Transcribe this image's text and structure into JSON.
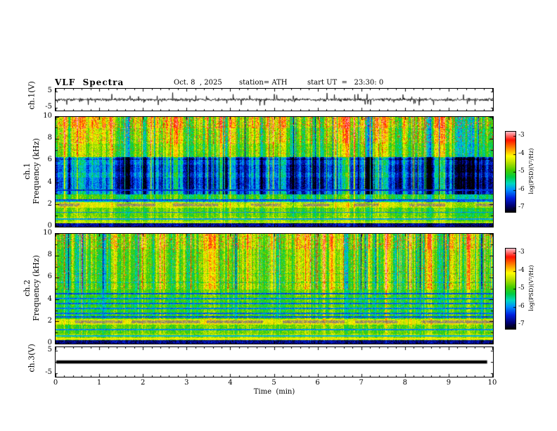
{
  "title": {
    "main": "VLF  Spectra",
    "date": "Oct. 8  , 2025",
    "station": "station= ATH",
    "start_ut": "start UT  =   23:30: 0"
  },
  "axes": {
    "time_label": "Time  (min)",
    "time_ticks": [
      "0",
      "1",
      "2",
      "3",
      "4",
      "5",
      "6",
      "7",
      "8",
      "9",
      "10"
    ],
    "freq_ticks": [
      "0",
      "2",
      "4",
      "6",
      "8",
      "10"
    ],
    "volt_tick_top": "5",
    "volt_tick_bottom": "-5",
    "wave1_label": "ch.1(V)",
    "wave3_label": "ch.3(V)",
    "spec1_ch": "ch.1",
    "spec2_ch": "ch.2",
    "freq_axis_label": "Frequency (kHz)",
    "colorbar_label": "log(PSD)(V²/Hz)",
    "colorbar_ticks": [
      "-3",
      "-4",
      "-5",
      "-6",
      "-7"
    ]
  },
  "colormap": {
    "stops": [
      [
        0.0,
        "#000000"
      ],
      [
        0.08,
        "#000070"
      ],
      [
        0.18,
        "#0020e0"
      ],
      [
        0.28,
        "#0090ff"
      ],
      [
        0.36,
        "#00d8c0"
      ],
      [
        0.44,
        "#00cc44"
      ],
      [
        0.52,
        "#44cc00"
      ],
      [
        0.62,
        "#b8e000"
      ],
      [
        0.7,
        "#ffff00"
      ],
      [
        0.8,
        "#ff8800"
      ],
      [
        0.9,
        "#ff1100"
      ],
      [
        1.0,
        "#ffb6c1"
      ]
    ],
    "zmin": -7,
    "zmax": -3
  },
  "chart_data": [
    {
      "panel": "ch1_waveform",
      "type": "line",
      "ylabel": "ch.1(V)",
      "ylim": [
        -6.5,
        6.5
      ],
      "yticks": [
        5,
        -5
      ],
      "xlim": [
        0,
        10
      ],
      "description": "Broadband VLF waveform: continuous noise of roughly ±1 V about 0 V with frequent impulsive sferic spikes reaching ±2 to ±4.5 V across the whole 10-minute record",
      "render": {
        "seed": 42,
        "noise_std": 0.7,
        "spike_prob": 0.045,
        "spike_amp": [
          0.8,
          3.8
        ]
      }
    },
    {
      "panel": "ch1_spectrogram",
      "type": "heatmap",
      "ylabel": "ch.1 Frequency (kHz)",
      "xlabel": "Time (min)",
      "xlim": [
        0,
        10
      ],
      "ylim": [
        0,
        10
      ],
      "zlim": [
        -7,
        -3
      ],
      "colorbar": "log(PSD)(V²/Hz)",
      "features": [
        "8-10 kHz: intense red/orange impulsive vertical sferic streaks on yellow-green background",
        "6.5-8 kHz: green background with yellow vertical streaks",
        "3-6.5 kHz: low-power dark blue region crossed by vertical green sferic streaks",
        "~2 kHz: strong quasi-continuous emission band (yellow/tan with gray saturated segments)",
        "0.3-2.6 kHz: structured green/yellow layers with narrow dark lines near 0.75, 1.35 and 2.45 kHz",
        "0-0.3 kHz: near-black low-frequency cutoff"
      ],
      "render": {
        "seed": 7,
        "burst_prob": 0.06,
        "dip_prob": 0.03,
        "bands": [
          {
            "f": [
              9.0,
              10.01
            ],
            "v": 0.62,
            "streak": 0.3,
            "speckle": 0.22
          },
          {
            "f": [
              7.6,
              9.0
            ],
            "v": 0.57,
            "streak": 0.26,
            "speckle": 0.12
          },
          {
            "f": [
              6.4,
              7.6
            ],
            "v": 0.53,
            "streak": 0.22,
            "speckle": 0.04
          },
          {
            "f": [
              3.0,
              6.4
            ],
            "v": 0.25,
            "streak": 0.26,
            "speckle": 0
          },
          {
            "f": [
              2.55,
              3.0
            ],
            "v": 0.47,
            "streak": 0.14,
            "speckle": 0
          },
          {
            "f": [
              2.25,
              2.55
            ],
            "v": 0.33,
            "streak": 0.1,
            "speckle": 0
          },
          {
            "f": [
              1.75,
              2.25
            ],
            "v": 0.64,
            "streak": 0.08,
            "speckle": 0
          },
          {
            "f": [
              0.9,
              1.75
            ],
            "v": 0.53,
            "streak": 0.1,
            "speckle": 0
          },
          {
            "f": [
              0.35,
              0.9
            ],
            "v": 0.58,
            "streak": 0.08,
            "speckle": 0
          },
          {
            "f": [
              0.0,
              0.35
            ],
            "v": 0.1,
            "streak": 0.05,
            "speckle": 0
          }
        ],
        "lines": [
          {
            "f": 4.0,
            "w": 0.5,
            "dv": -0.06
          },
          {
            "f": 5.3,
            "w": 0.35,
            "dv": -0.05
          },
          {
            "f": 6.2,
            "w": 0.06,
            "dv": -0.1
          },
          {
            "f": 3.35,
            "w": 0.08,
            "v": 0.18
          },
          {
            "f": 2.45,
            "w": 0.07,
            "v": 0.22
          },
          {
            "f": 1.35,
            "w": 0.06,
            "v": 0.28
          },
          {
            "f": 0.75,
            "w": 0.06,
            "v": 0.3
          },
          {
            "f": 0.45,
            "w": 0.05,
            "v": 0.66
          }
        ],
        "gray_band": {
          "f": [
            1.85,
            2.12
          ],
          "seg": [
            25,
            70
          ],
          "gap": [
            20,
            60
          ],
          "rgb": [
            150,
            142,
            105
          ]
        }
      }
    },
    {
      "panel": "ch2_spectrogram",
      "type": "heatmap",
      "ylabel": "ch.2 Frequency (kHz)",
      "xlabel": "Time (min)",
      "xlim": [
        0,
        10
      ],
      "ylim": [
        0,
        10
      ],
      "zlim": [
        -7,
        -3
      ],
      "colorbar": "log(PSD)(V²/Hz)",
      "features": [
        "8.5-10 kHz: red impulsive sferic streaks on yellow-green background",
        "5-8.5 kHz: green/yellow vertical striations with occasional dark blue columns",
        "2.3-4.7 kHz: green region with many narrow dark horizontal lines (~2.45, 2.8, 3.25, 3.7, 4.15, 4.6 kHz)",
        "~2 kHz: strong quasi-continuous emission band (yellow with long gray saturated segments)",
        "0.3-1.8 kHz: bright green/yellow layers with dark lines near 0.75 and 1.3 kHz",
        "0-0.3 kHz: near-black low-frequency cutoff"
      ],
      "render": {
        "seed": 13,
        "burst_prob": 0.05,
        "dip_prob": 0.05,
        "bands": [
          {
            "f": [
              8.6,
              10.01
            ],
            "v": 0.6,
            "streak": 0.28,
            "speckle": 0.16
          },
          {
            "f": [
              5.0,
              8.6
            ],
            "v": 0.56,
            "streak": 0.24,
            "speckle": 0.05
          },
          {
            "f": [
              4.4,
              5.0
            ],
            "v": 0.52,
            "streak": 0.14,
            "speckle": 0
          },
          {
            "f": [
              2.3,
              4.4
            ],
            "v": 0.5,
            "streak": 0.12,
            "speckle": 0
          },
          {
            "f": [
              1.75,
              2.25
            ],
            "v": 0.68,
            "streak": 0.06,
            "speckle": 0
          },
          {
            "f": [
              0.9,
              1.75
            ],
            "v": 0.55,
            "streak": 0.08,
            "speckle": 0
          },
          {
            "f": [
              0.35,
              0.9
            ],
            "v": 0.6,
            "streak": 0.06,
            "speckle": 0
          },
          {
            "f": [
              0.0,
              0.35
            ],
            "v": 0.1,
            "streak": 0.04,
            "speckle": 0
          }
        ],
        "lines": [
          {
            "f": 4.6,
            "w": 0.07,
            "v": 0.22
          },
          {
            "f": 4.15,
            "w": 0.05,
            "v": 0.26
          },
          {
            "f": 3.7,
            "w": 0.05,
            "v": 0.24
          },
          {
            "f": 3.25,
            "w": 0.05,
            "v": 0.26
          },
          {
            "f": 2.8,
            "w": 0.05,
            "v": 0.24
          },
          {
            "f": 2.45,
            "w": 0.06,
            "v": 0.22
          },
          {
            "f": 1.3,
            "w": 0.05,
            "v": 0.28
          },
          {
            "f": 0.75,
            "w": 0.05,
            "v": 0.32
          },
          {
            "f": 0.5,
            "w": 0.06,
            "v": 0.7
          },
          {
            "f": 5.6,
            "w": 0.05,
            "dv": -0.08
          },
          {
            "f": 6.4,
            "w": 0.05,
            "dv": -0.07
          }
        ],
        "gray_band": {
          "f": [
            1.85,
            2.12
          ],
          "seg": [
            50,
            110
          ],
          "gap": [
            10,
            35
          ],
          "rgb": [
            148,
            140,
            104
          ]
        }
      }
    },
    {
      "panel": "ch3_waveform",
      "type": "line",
      "ylabel": "ch.3(V)",
      "ylim": [
        -6.5,
        6.5
      ],
      "yticks": [
        5,
        -5
      ],
      "xlim": [
        0,
        10
      ],
      "description": "Channel 3 is flat at 0 V for the entire record (no signal) - rendered as a thick black horizontal line",
      "render": {
        "value": 0,
        "thickness": 4.5
      }
    }
  ]
}
